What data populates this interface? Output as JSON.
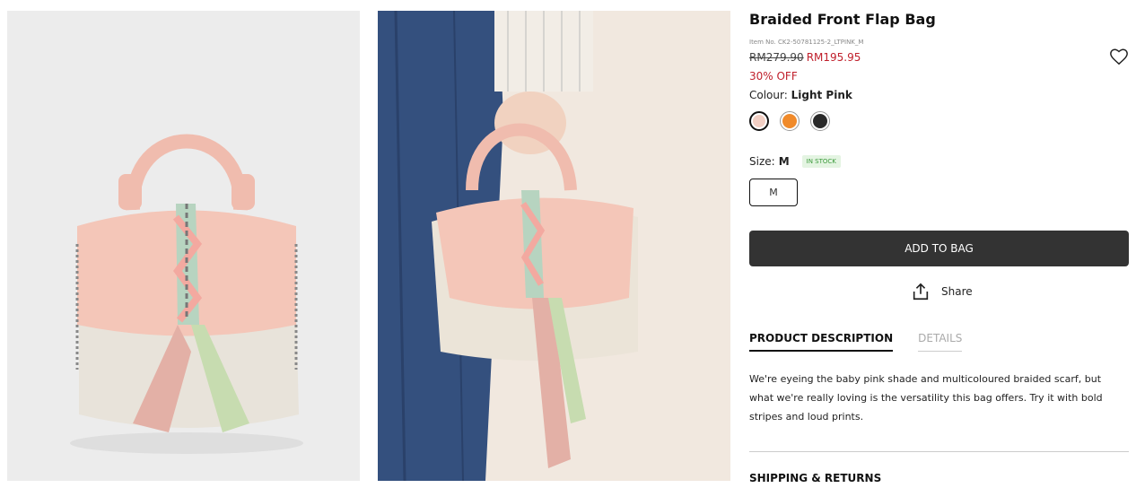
{
  "product": {
    "title": "Braided Front Flap Bag",
    "item_no": "Item No. CK2-50781125-2_LTPINK_M",
    "old_price": "RM279.90",
    "new_price": "RM195.95",
    "discount": "30% OFF",
    "colour_label": "Colour:",
    "colour_value": "Light Pink",
    "size_label": "Size:",
    "size_value": "M",
    "stock_badge": "IN STOCK",
    "size_option": "M"
  },
  "swatches": [
    {
      "name": "Light Pink",
      "color": "#f2cfc4",
      "selected": true
    },
    {
      "name": "Orange",
      "color": "#f08a2a",
      "selected": false
    },
    {
      "name": "Black",
      "color": "#2a2a2a",
      "selected": false
    }
  ],
  "actions": {
    "add_to_bag": "ADD TO BAG",
    "share": "Share"
  },
  "tabs": [
    {
      "label": "PRODUCT DESCRIPTION",
      "active": true
    },
    {
      "label": "DETAILS",
      "active": false
    }
  ],
  "description": "We're eyeing the baby pink shade and multicoloured braided scarf, but what we're really loving is the versatility this bag offers. Try it with bold stripes and loud prints.",
  "shipping_label": "SHIPPING & RETURNS",
  "colors": {
    "accent": "#333333",
    "sale": "#c0202c",
    "stock_bg": "#e4f4e2",
    "stock_text": "#3a9a3a"
  }
}
